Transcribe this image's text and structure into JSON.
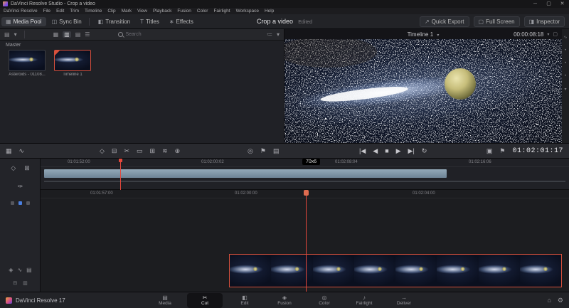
{
  "window": {
    "title": "DaVinci Resolve Studio - Crop a video"
  },
  "menu": {
    "items": [
      "DaVinci Resolve",
      "File",
      "Edit",
      "Trim",
      "Timeline",
      "Clip",
      "Mark",
      "View",
      "Playback",
      "Fusion",
      "Color",
      "Fairlight",
      "Workspace",
      "Help"
    ]
  },
  "header": {
    "title": "Crop a video",
    "status": "Edited",
    "buttons_left": [
      {
        "label": "Media Pool"
      },
      {
        "label": "Sync Bin"
      },
      {
        "label": "Transition"
      },
      {
        "label": "Titles"
      },
      {
        "label": "Effects"
      }
    ],
    "buttons_right": [
      {
        "label": "Quick Export"
      },
      {
        "label": "Full Screen"
      },
      {
        "label": "Inspector"
      }
    ]
  },
  "media_pool": {
    "bin": "Master",
    "search_label": "Search",
    "clips": [
      {
        "name": "Asteroids - 01108...",
        "selected": false
      },
      {
        "name": "Timeline 1",
        "selected": true
      }
    ]
  },
  "viewer": {
    "source": "Timeline 1",
    "duration": "00:00:08:18"
  },
  "transport": {
    "timecode": "01:02:01:17"
  },
  "timeline": {
    "zoom_tooltip": "70x6",
    "upper_labels": [
      "01:01:52:00",
      "01:02:00:02",
      "01:02:08:04",
      "01:02:16:06"
    ],
    "main_labels": [
      "01:01:57:00",
      "01:02:00:00",
      "01:02:04:00"
    ]
  },
  "pages": {
    "tabs": [
      "Media",
      "Cut",
      "Edit",
      "Fusion",
      "Color",
      "Fairlight",
      "Deliver"
    ],
    "active": "Cut"
  },
  "footer": {
    "version": "DaVinci Resolve 17"
  },
  "colors": {
    "accent_red": "#e5483c",
    "selection_orange": "#d5503b",
    "overview_bar_blue": "#7f95a5",
    "panel_bg": "#222327"
  },
  "icons": {
    "app": "◆",
    "minimize": "─",
    "maximize": "▢",
    "close": "✕",
    "chevron_down": "▾",
    "media_pool": "▦",
    "sync_bin": "◫",
    "transition": "◧",
    "titles": "T",
    "effects": "∗",
    "quick_export": "↗",
    "full_screen": "▢",
    "inspector": "◨",
    "film": "▤",
    "grid": "▦",
    "thumb_view": "▥",
    "strip_view": "▤",
    "list_view": "☰",
    "sort": "≔",
    "search": "magnifier-shape",
    "audio": "∿",
    "tool_select": "◇",
    "tool_trim": "⊟",
    "tool_razor": "✂",
    "tool_ripple": "▭",
    "tool_snap": "⊞",
    "tool_wave": "≋",
    "tool_add": "⊕",
    "monitor": "◎",
    "marker": "⚑",
    "camera": "▣",
    "prev": "|◀",
    "step_back": "◀",
    "stop": "■",
    "play": "▶",
    "next": "▶|",
    "loop": "↻",
    "lock": "◈",
    "speaker": "∿",
    "video_track": "▤",
    "pen": "✑",
    "dot": "•",
    "home": "⌂",
    "gear": "⚙",
    "tab_media": "▤",
    "tab_cut": "✂",
    "tab_edit": "◧",
    "tab_fusion": "◈",
    "tab_color": "◎",
    "tab_fairlight": "♪",
    "tab_deliver": "→"
  }
}
